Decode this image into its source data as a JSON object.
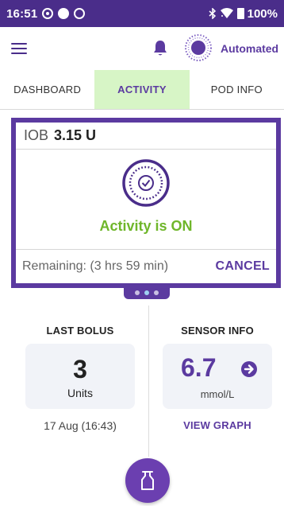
{
  "status_bar": {
    "time": "16:51",
    "battery": "100%"
  },
  "header": {
    "mode_label": "Automated",
    "icons": [
      "menu-icon",
      "bell-icon",
      "automated-mode-icon"
    ]
  },
  "tabs": [
    {
      "label": "DASHBOARD",
      "active": false
    },
    {
      "label": "ACTIVITY",
      "active": true
    },
    {
      "label": "POD INFO",
      "active": false
    }
  ],
  "card": {
    "iob_label": "IOB",
    "iob_value": "3.15 U",
    "activity_status": "Activity is ON",
    "remaining": "Remaining: (3 hrs 59 min)",
    "cancel_label": "CANCEL"
  },
  "pager": {
    "count": 3,
    "active_index": 1
  },
  "last_bolus": {
    "title": "LAST BOLUS",
    "amount": "3",
    "unit": "Units",
    "date": "17 Aug (16:43)"
  },
  "sensor_info": {
    "title": "SENSOR INFO",
    "value": "6.7",
    "unit": "mmol/L",
    "trend_icon": "arrow-right-icon",
    "link_label": "VIEW GRAPH"
  },
  "colors": {
    "primary": "#5b3aa0",
    "status_bar": "#4a2d8a",
    "activity_green": "#6fb62a",
    "active_tab_bg": "#d7f5c6",
    "bell": "#5b3aa0"
  }
}
